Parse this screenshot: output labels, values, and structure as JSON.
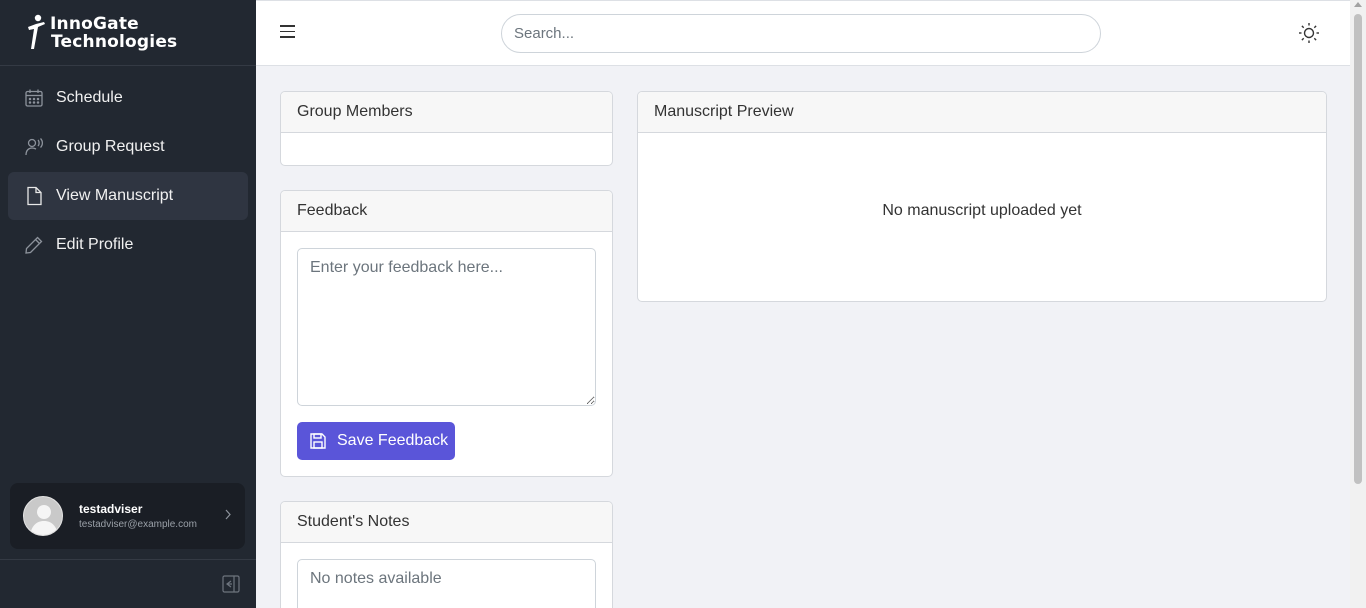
{
  "brand": {
    "line1": "InnoGate",
    "line2": "Technologies"
  },
  "sidebar": {
    "items": [
      {
        "label": "Schedule",
        "icon": "calendar-icon",
        "active": false
      },
      {
        "label": "Group Request",
        "icon": "user-voice-icon",
        "active": false
      },
      {
        "label": "View Manuscript",
        "icon": "document-icon",
        "active": true
      },
      {
        "label": "Edit Profile",
        "icon": "pencil-icon",
        "active": false
      }
    ]
  },
  "user": {
    "name": "testadviser",
    "email": "testadviser@example.com"
  },
  "header": {
    "search_placeholder": "Search..."
  },
  "cards": {
    "group_members": {
      "title": "Group Members"
    },
    "feedback": {
      "title": "Feedback",
      "placeholder": "Enter your feedback here...",
      "save_label": "Save Feedback"
    },
    "student_notes": {
      "title": "Student's Notes",
      "empty": "No notes available"
    },
    "manuscript_preview": {
      "title": "Manuscript Preview",
      "empty": "No manuscript uploaded yet"
    }
  },
  "colors": {
    "sidebar_bg": "#222831",
    "accent": "#5a55d9",
    "page_bg": "#f1f2f6"
  }
}
